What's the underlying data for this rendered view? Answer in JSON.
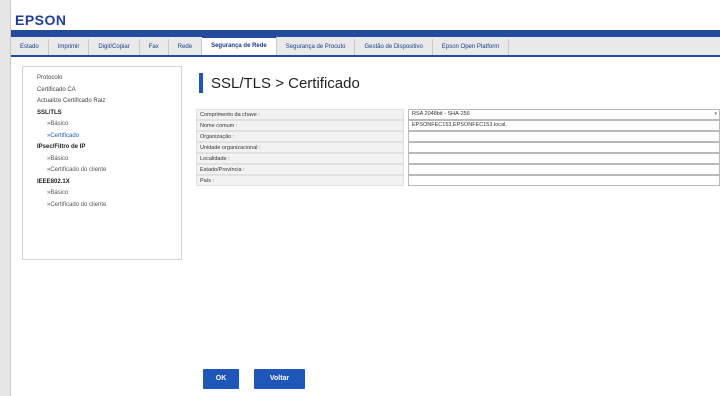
{
  "brand": {
    "logo": "EPSON"
  },
  "tabs": [
    {
      "label": "Estado",
      "active": false
    },
    {
      "label": "Imprimir",
      "active": false
    },
    {
      "label": "Digit/Copiar",
      "active": false
    },
    {
      "label": "Fax",
      "active": false
    },
    {
      "label": "Rede",
      "active": false
    },
    {
      "label": "Segurança de Rede",
      "active": true
    },
    {
      "label": "Segurança de Procuto",
      "active": false
    },
    {
      "label": "Gestão de Dispositivo",
      "active": false
    },
    {
      "label": "Epson Open Platform",
      "active": false
    }
  ],
  "sidebar": {
    "items": [
      {
        "label": "Protocolo"
      },
      {
        "label": "Certificado CA"
      },
      {
        "label": "Actualize Certificado Raiz"
      },
      {
        "label": "SSL/TLS"
      },
      {
        "label": "»Básico"
      },
      {
        "label": "»Certificado"
      },
      {
        "label": "IPsec/Filtro de IP"
      },
      {
        "label": "»Básico"
      },
      {
        "label": "»Certificado do cliente"
      },
      {
        "label": "IEEE802.1X"
      },
      {
        "label": "»Básico"
      },
      {
        "label": "»Certificado do cliente"
      }
    ]
  },
  "main": {
    "title": "SSL/TLS > Certificado"
  },
  "form": {
    "rows": [
      {
        "label": "Comprimento da chave :",
        "value": "RSA 2048bit - SHA-256"
      },
      {
        "label": "Nome comum :",
        "value": "EPSONFEC153,EPSONFEC153.local,"
      },
      {
        "label": "Organização :",
        "value": ""
      },
      {
        "label": "Unidade organizacional :",
        "value": ""
      },
      {
        "label": "Localidade :",
        "value": ""
      },
      {
        "label": "Estado/Província :",
        "value": ""
      },
      {
        "label": "País :",
        "value": ""
      }
    ]
  },
  "buttons": {
    "ok": "OK",
    "back": "Voltar"
  },
  "colors": {
    "accent": "#1f56b9",
    "brand": "#1e3e9a"
  }
}
